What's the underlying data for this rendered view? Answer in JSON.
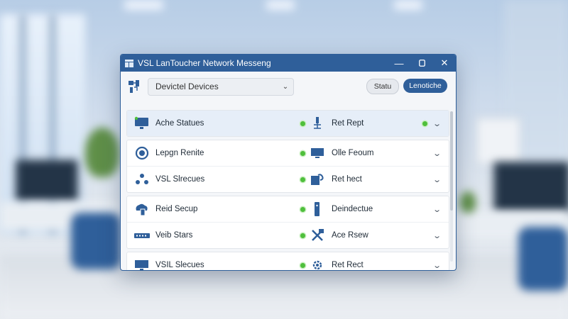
{
  "window": {
    "title": "VSL LanToucher Network Messeng"
  },
  "toolbar": {
    "device_select": {
      "value": "Devictel Devices",
      "icon": "device-icon"
    },
    "status_button": "Statu",
    "connect_button": "Lenotiche"
  },
  "groups": [
    {
      "rows": [
        {
          "left_icon": "monitor-icon",
          "left_label": "Ache Statues",
          "right_icon": "mic-stand-icon",
          "right_label": "Ret Rept",
          "right_dot": true,
          "selected": true
        }
      ]
    },
    {
      "rows": [
        {
          "left_icon": "circle-icon",
          "left_label": "Lepgn Renite",
          "right_icon": "monitor-icon",
          "right_label": "Olle Feoum",
          "right_dot": false,
          "selected": false
        },
        {
          "left_icon": "users-icon",
          "left_label": "VSL Slrecues",
          "right_icon": "puzzle-icon",
          "right_label": "Ret hect",
          "right_dot": false,
          "selected": false
        }
      ]
    },
    {
      "rows": [
        {
          "left_icon": "cloud-device-icon",
          "left_label": "Reid Secup",
          "right_icon": "phone-icon",
          "right_label": "Deindectue",
          "right_dot": false,
          "selected": false
        },
        {
          "left_icon": "switch-icon",
          "left_label": "Veib Stars",
          "right_icon": "cables-icon",
          "right_label": "Ace Rsew",
          "right_dot": false,
          "selected": false
        }
      ]
    },
    {
      "rows": [
        {
          "left_icon": "monitor-icon",
          "left_label": "VSIL Slecues",
          "right_icon": "gear-icon",
          "right_label": "Ret Rect",
          "right_dot": false,
          "selected": false
        }
      ]
    }
  ],
  "colors": {
    "accent": "#2f5f9a",
    "online": "#4fbf3c"
  }
}
